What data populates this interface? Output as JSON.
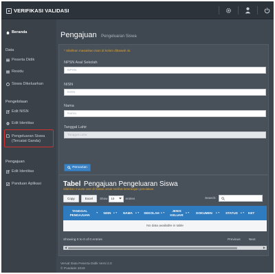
{
  "app": {
    "title": "VERIFIKASI VALIDASI"
  },
  "topbar": {
    "icons": [
      "gear-icon",
      "user-icon",
      "power-icon"
    ]
  },
  "sidebar": {
    "home": "Beranda",
    "sections": [
      {
        "label": "Data",
        "items": [
          "Peserta Didik",
          "Residu",
          "Siswa Dikeluarkan"
        ]
      },
      {
        "label": "Pengelolaan",
        "items": [
          "Edit NISN",
          "Edit Identitas",
          "Pengeluaran Siswa (Tercatat Ganda)"
        ]
      },
      {
        "label": "Pengajuan",
        "items": [
          "Edit Identitas",
          "Panduan Aplikasi"
        ]
      }
    ],
    "highlight_color": "#d6312d"
  },
  "page": {
    "title": "Pengajuan",
    "subtitle": "Pengeluaran Siswa"
  },
  "form": {
    "hint": "* Silahkan masukkan isian di kolom dibawah ini.",
    "fields": [
      {
        "label": "NPSN Asal Sekolah",
        "placeholder": "NPSN"
      },
      {
        "label": "NISN",
        "placeholder": "NISN"
      },
      {
        "label": "Nama",
        "placeholder": "Nama"
      },
      {
        "label": "Tanggal Lahir",
        "placeholder": "Tanggal Lahir"
      }
    ],
    "search_button": "Pencarian"
  },
  "table": {
    "title_bold": "Tabel",
    "title_rest": "Pengajuan Pengeluaran Siswa",
    "hint": "Silahkan mouse over di Status untuk melihat keterangan penolakan.",
    "copy": "Copy",
    "excel": "Excel",
    "show_label": "Show",
    "show_value": "10",
    "entries_label": "entries",
    "search_label": "Search:",
    "columns": [
      "TANGGAL PENGAJUAN",
      "NISN",
      "NAMA",
      "SEKOLAH",
      "JENIS KELUAR",
      "DOKUMEN",
      "STATUS",
      "KET"
    ],
    "empty": "No data available in table",
    "info": "Showing 0 to 0 of 0 entries",
    "previous": "Previous",
    "next": "Next",
    "accent": "#2f7bc0"
  },
  "footer": {
    "line1": "Verval Data Peserta Didik Versi 2.0",
    "line2": "© Pusdatin 2019"
  },
  "colors": {
    "background": "#3f4750",
    "topbar": "#2c333b",
    "hint": "#e6a52a",
    "button": "#3a82c4"
  }
}
